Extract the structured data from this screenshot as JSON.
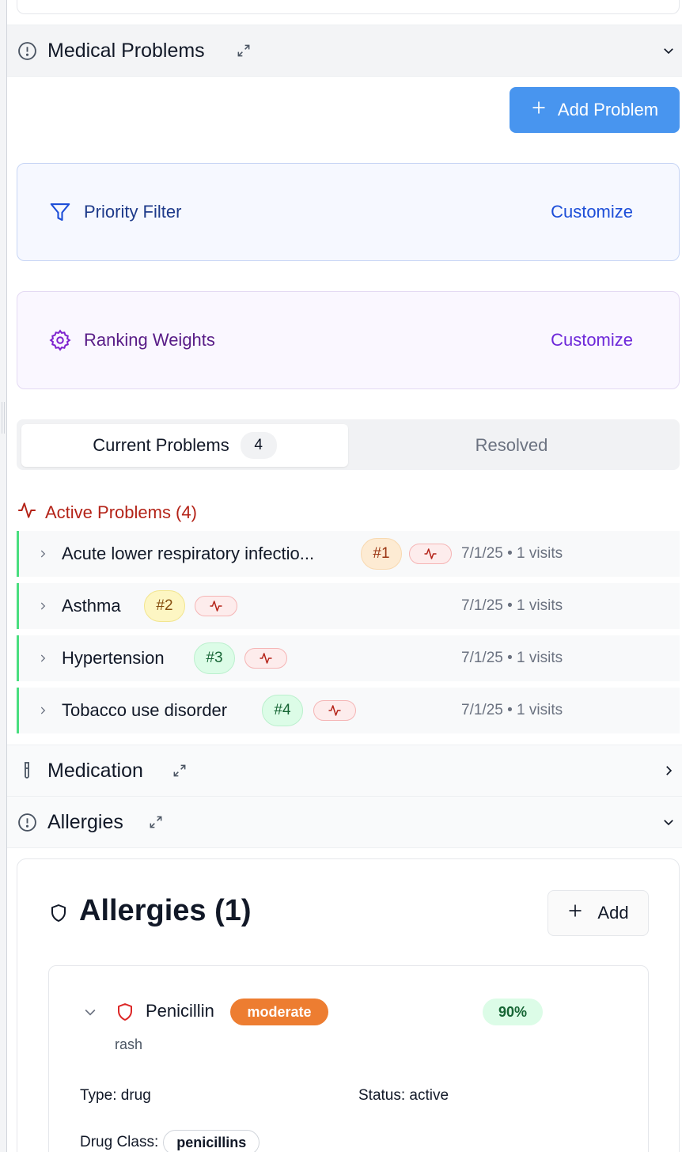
{
  "sections": {
    "medical_problems": {
      "title": "Medical Problems",
      "expanded": true
    },
    "medication": {
      "title": "Medication",
      "expanded": false
    },
    "allergies": {
      "title": "Allergies",
      "expanded": true
    }
  },
  "problems": {
    "add_button_label": "Add Problem",
    "priority_filter": {
      "label": "Priority Filter",
      "action": "Customize"
    },
    "ranking_weights": {
      "label": "Ranking Weights",
      "action": "Customize"
    },
    "tabs": [
      {
        "label": "Current Problems",
        "count": "4",
        "selected": true
      },
      {
        "label": "Resolved",
        "selected": false
      }
    ],
    "active_title": "Active Problems (4)",
    "items": [
      {
        "name": "Acute lower respiratory infectio...",
        "rank": "#1",
        "meta": "7/1/25 • 1 visits"
      },
      {
        "name": "Asthma",
        "rank": "#2",
        "meta": "7/1/25 • 1 visits"
      },
      {
        "name": "Hypertension",
        "rank": "#3",
        "meta": "7/1/25 • 1 visits"
      },
      {
        "name": "Tobacco use disorder",
        "rank": "#4",
        "meta": "7/1/25 • 1 visits"
      }
    ]
  },
  "allergies_panel": {
    "title": "Allergies (1)",
    "add_label": "Add",
    "items": [
      {
        "name": "Penicillin",
        "severity": "moderate",
        "confidence": "90%",
        "reaction": "rash",
        "type_text": "Type: drug",
        "status_text": "Status: active",
        "drug_class_label": "Drug Class:",
        "drug_class": "penicillins"
      }
    ]
  },
  "colors": {
    "primary": "#4895ef",
    "active_red": "#b42318",
    "severity_moderate": "#ed7d31",
    "active_border": "#4ade80"
  }
}
